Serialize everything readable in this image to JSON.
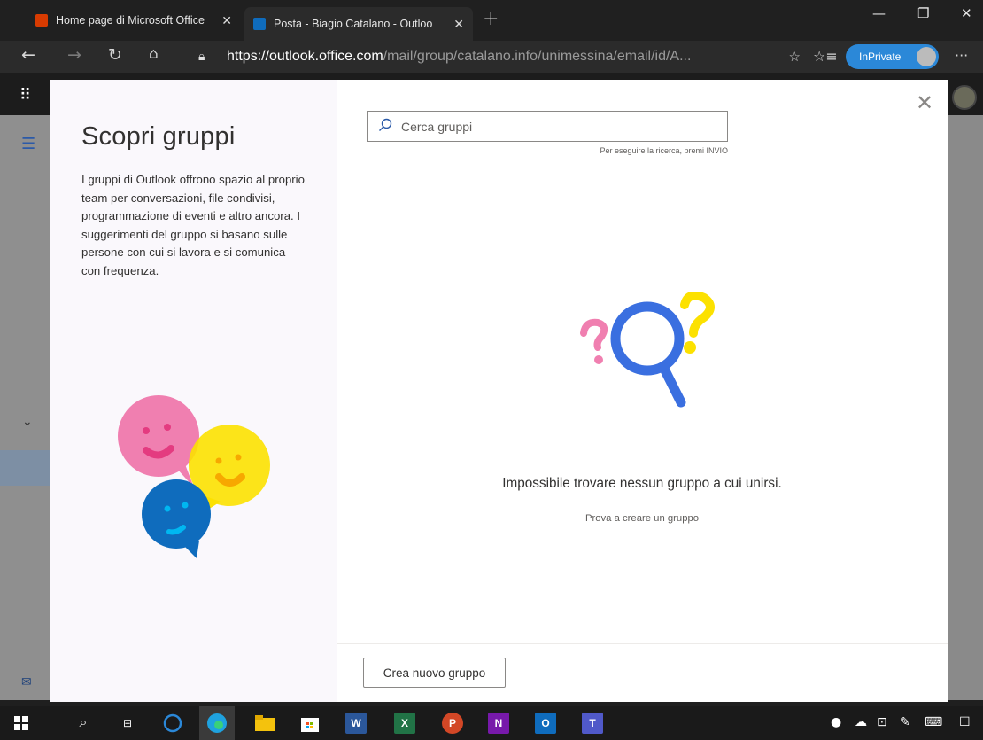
{
  "browser": {
    "tabs": [
      {
        "title": "Home page di Microsoft Office",
        "icon": "office-icon",
        "active": false
      },
      {
        "title": "Posta - Biagio Catalano - Outloo",
        "icon": "outlook-icon",
        "active": true
      }
    ],
    "url_host": "https://outlook.office.com",
    "url_path": "/mail/group/catalano.info/unimessina/email/id/A...",
    "inprivate_label": "InPrivate"
  },
  "modal": {
    "title": "Scopri gruppi",
    "description": "I gruppi di Outlook offrono spazio al proprio team per conversazioni, file condivisi, programmazione di eventi e altro ancora. I suggerimenti del gruppo si basano sulle persone con cui si lavora e si comunica con frequenza.",
    "search": {
      "placeholder": "Cerca gruppi",
      "hint": "Per eseguire la ricerca, premi INVIO"
    },
    "empty_title": "Impossibile trovare nessun gruppo a cui unirsi.",
    "empty_subtitle": "Prova a creare un gruppo",
    "create_button": "Crea nuovo gruppo"
  },
  "taskbar": {
    "items": [
      "start-icon",
      "search-icon",
      "task-view-icon",
      "cortana-icon",
      "edge-icon",
      "file-explorer-icon",
      "store-icon",
      "word-icon",
      "excel-icon",
      "powerpoint-icon",
      "onenote-icon",
      "outlook-icon",
      "teams-icon"
    ]
  },
  "colors": {
    "accent": "#0078d4",
    "inprivate": "#2b88d8"
  }
}
